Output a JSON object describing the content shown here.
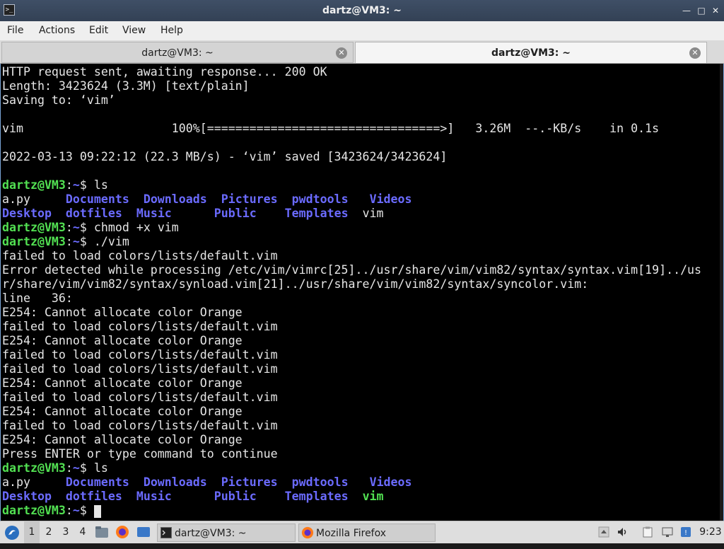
{
  "window": {
    "title": "dartz@VM3: ~",
    "title_icon": ">_"
  },
  "window_buttons": {
    "minimize": "—",
    "maximize": "□",
    "close": "✕"
  },
  "menu": [
    "File",
    "Actions",
    "Edit",
    "View",
    "Help"
  ],
  "tabs": [
    {
      "label": "dartz@VM3: ~",
      "active": false
    },
    {
      "label": "dartz@VM3: ~",
      "active": true
    }
  ],
  "tab_close_glyph": "✕",
  "terminal": {
    "lines": [
      [
        "HTTP request sent, awaiting response... 200 OK"
      ],
      [
        "Length: 3423624 (3.3M) [text/plain]"
      ],
      [
        "Saving to: ‘vim’"
      ],
      [
        ""
      ],
      [
        "vim                     100%[=================================>]   3.26M  --.-KB/s    in 0.1s"
      ],
      [
        ""
      ],
      [
        "2022-03-13 09:22:12 (22.3 MB/s) - ‘vim’ saved [3423624/3423624]"
      ],
      [
        ""
      ],
      [
        {
          "t": "dartz@VM3",
          "c": "g"
        },
        {
          "t": ":"
        },
        {
          "t": "~",
          "c": "b"
        },
        {
          "t": "$ ls"
        }
      ],
      [
        {
          "t": "a.py     "
        },
        {
          "t": "Documents",
          "c": "b"
        },
        {
          "t": "  "
        },
        {
          "t": "Downloads",
          "c": "b"
        },
        {
          "t": "  "
        },
        {
          "t": "Pictures",
          "c": "b"
        },
        {
          "t": "  "
        },
        {
          "t": "pwdtools",
          "c": "b"
        },
        {
          "t": "   "
        },
        {
          "t": "Videos",
          "c": "b"
        }
      ],
      [
        {
          "t": "Desktop",
          "c": "b"
        },
        {
          "t": "  "
        },
        {
          "t": "dotfiles",
          "c": "b"
        },
        {
          "t": "  "
        },
        {
          "t": "Music",
          "c": "b"
        },
        {
          "t": "      "
        },
        {
          "t": "Public",
          "c": "b"
        },
        {
          "t": "    "
        },
        {
          "t": "Templates",
          "c": "b"
        },
        {
          "t": "  vim"
        }
      ],
      [
        {
          "t": "dartz@VM3",
          "c": "g"
        },
        {
          "t": ":"
        },
        {
          "t": "~",
          "c": "b"
        },
        {
          "t": "$ chmod +x vim"
        }
      ],
      [
        {
          "t": "dartz@VM3",
          "c": "g"
        },
        {
          "t": ":"
        },
        {
          "t": "~",
          "c": "b"
        },
        {
          "t": "$ ./vim"
        }
      ],
      [
        "failed to load colors/lists/default.vim"
      ],
      [
        "Error detected while processing /etc/vim/vimrc[25]../usr/share/vim/vim82/syntax/syntax.vim[19]../us"
      ],
      [
        "r/share/vim/vim82/syntax/synload.vim[21]../usr/share/vim/vim82/syntax/syncolor.vim:"
      ],
      [
        "line   36:"
      ],
      [
        "E254: Cannot allocate color Orange"
      ],
      [
        "failed to load colors/lists/default.vim"
      ],
      [
        "E254: Cannot allocate color Orange"
      ],
      [
        "failed to load colors/lists/default.vim"
      ],
      [
        "failed to load colors/lists/default.vim"
      ],
      [
        "E254: Cannot allocate color Orange"
      ],
      [
        "failed to load colors/lists/default.vim"
      ],
      [
        "E254: Cannot allocate color Orange"
      ],
      [
        "failed to load colors/lists/default.vim"
      ],
      [
        "E254: Cannot allocate color Orange"
      ],
      [
        "Press ENTER or type command to continue"
      ],
      [
        {
          "t": "dartz@VM3",
          "c": "g"
        },
        {
          "t": ":"
        },
        {
          "t": "~",
          "c": "b"
        },
        {
          "t": "$ ls"
        }
      ],
      [
        {
          "t": "a.py     "
        },
        {
          "t": "Documents",
          "c": "b"
        },
        {
          "t": "  "
        },
        {
          "t": "Downloads",
          "c": "b"
        },
        {
          "t": "  "
        },
        {
          "t": "Pictures",
          "c": "b"
        },
        {
          "t": "  "
        },
        {
          "t": "pwdtools",
          "c": "b"
        },
        {
          "t": "   "
        },
        {
          "t": "Videos",
          "c": "b"
        }
      ],
      [
        {
          "t": "Desktop",
          "c": "b"
        },
        {
          "t": "  "
        },
        {
          "t": "dotfiles",
          "c": "b"
        },
        {
          "t": "  "
        },
        {
          "t": "Music",
          "c": "b"
        },
        {
          "t": "      "
        },
        {
          "t": "Public",
          "c": "b"
        },
        {
          "t": "    "
        },
        {
          "t": "Templates",
          "c": "b"
        },
        {
          "t": "  "
        },
        {
          "t": "vim",
          "c": "bg"
        }
      ],
      [
        {
          "t": "dartz@VM3",
          "c": "g"
        },
        {
          "t": ":"
        },
        {
          "t": "~",
          "c": "b"
        },
        {
          "t": "$ "
        },
        {
          "cursor": true
        }
      ]
    ]
  },
  "taskbar": {
    "workspaces": [
      "1",
      "2",
      "3",
      "4"
    ],
    "active_workspace": "1",
    "tasks": [
      {
        "label": "dartz@VM3: ~",
        "icon": "terminal-icon"
      },
      {
        "label": "Mozilla Firefox",
        "icon": "firefox-icon"
      }
    ],
    "clock": "9:23"
  },
  "colors": {
    "prompt_green": "#52e052",
    "dir_blue": "#6b6bff",
    "terminal_bg": "#000000",
    "titlebar": "#3a4a60"
  }
}
